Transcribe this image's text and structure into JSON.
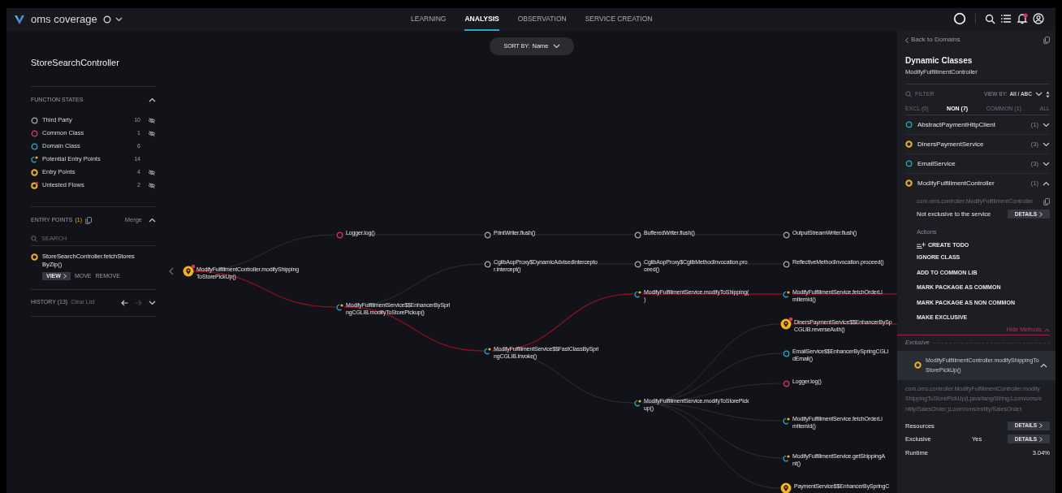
{
  "app": {
    "title": "oms coverage"
  },
  "nav_tabs": [
    {
      "label": "LEARNING",
      "selected": false
    },
    {
      "label": "ANALYSIS",
      "selected": true
    },
    {
      "label": "OBSERVATION",
      "selected": false
    },
    {
      "label": "SERVICE CREATION",
      "selected": false
    }
  ],
  "notifications": {
    "unread": true
  },
  "sort": {
    "label": "SORT BY:",
    "value": "Name"
  },
  "sidebar": {
    "title": "StoreSearchController",
    "function_states": {
      "heading": "FUNCTION STATES",
      "expanded": true,
      "items": [
        {
          "kind": "third_party",
          "label": "Third Party",
          "count": "10",
          "hidden": true
        },
        {
          "kind": "common",
          "label": "Common Class",
          "count": "1",
          "hidden": true
        },
        {
          "kind": "domain",
          "label": "Domain Class",
          "count": "6",
          "hidden": false
        },
        {
          "kind": "potential",
          "label": "Potential Entry Points",
          "count": "14",
          "hidden": false
        },
        {
          "kind": "entry",
          "label": "Entry Points",
          "count": "4",
          "hidden": true
        },
        {
          "kind": "untested",
          "label": "Untested Flows",
          "count": "2",
          "hidden": true
        }
      ]
    },
    "entry_points": {
      "heading": "ENTRY POINTS",
      "count": "(1)",
      "merge": "Merge",
      "expanded": true,
      "search_placeholder": "SEARCH",
      "items": [
        {
          "kind": "entry",
          "lines": [
            "StoreSearchController.fetchStores",
            "ByZip()"
          ],
          "actions": [
            "VIEW",
            "MOVE",
            "REMOVE"
          ]
        }
      ]
    },
    "history": {
      "heading": "HISTORY (13)",
      "clear": "Clear List",
      "forward_disabled": true,
      "expanded": false
    }
  },
  "graph": {
    "root": {
      "kind": "untested",
      "lines": [
        "ModifyFulfillmentController.modifyShipping",
        "ToStorePickUp()"
      ],
      "children": [
        {
          "kind": "common",
          "lines": [
            "Logger.log()"
          ],
          "path": false,
          "children": [
            {
              "kind": "third_party",
              "lines": [
                "PrintWriter.flush()"
              ],
              "path": false,
              "children": [
                {
                  "kind": "third_party",
                  "lines": [
                    "BufferedWriter.flush()"
                  ],
                  "path": false,
                  "children": [
                    {
                      "kind": "third_party",
                      "lines": [
                        "OutputStreamWriter.flush()"
                      ],
                      "path": false
                    }
                  ]
                }
              ]
            }
          ]
        },
        {
          "kind": "potential",
          "lines": [
            "ModifyFulfillmentService$$EnhancerBySpri",
            "ngCGLIB.modifyToStorePickup()"
          ],
          "path": true,
          "children": [
            {
              "kind": "third_party",
              "lines": [
                "CglibAopProxy$DynamicAdvisedIntercepto",
                "r.intercept()"
              ],
              "path": false,
              "children": [
                {
                  "kind": "third_party",
                  "lines": [
                    "CglibAopProxy$CglibMethodInvocation.pro",
                    "ceed()"
                  ],
                  "path": false,
                  "children": [
                    {
                      "kind": "third_party",
                      "lines": [
                        "ReflectiveMethodInvocation.proceed()"
                      ],
                      "path": false
                    }
                  ]
                }
              ]
            },
            {
              "kind": "potential",
              "lines": [
                "ModifyFulfillmentService$$FastClassBySpri",
                "ngCGLIB.invoke()"
              ],
              "path": true,
              "children": [
                {
                  "kind": "potential",
                  "lines": [
                    "ModifyFulfillmentService.modifyToShipping(",
                    ")"
                  ],
                  "path": true,
                  "children": [
                    {
                      "kind": "potential",
                      "lines": [
                        "ModifyFulfillmentService.fetchOrderLi",
                        "mItemId()"
                      ],
                      "path": true,
                      "continues": true
                    }
                  ]
                },
                {
                  "kind": "potential",
                  "lines": [
                    "ModifyFulfillmentService.modifyToStorePick",
                    "up()"
                  ],
                  "path": false,
                  "children": [
                    {
                      "kind": "untested",
                      "lines": [
                        "DinersPaymentService$$EnhancerBySp",
                        "CGLIB.reverseAuth()"
                      ],
                      "path": false,
                      "continues": true
                    },
                    {
                      "kind": "domain",
                      "lines": [
                        "EmailService$$EnhancerBySpringCGLI",
                        "dEmail()"
                      ],
                      "path": false
                    },
                    {
                      "kind": "common",
                      "lines": [
                        "Logger.log()"
                      ],
                      "path": false
                    },
                    {
                      "kind": "potential",
                      "lines": [
                        "ModifyFulfillmentService.fetchOrderLi",
                        "mItemId()"
                      ],
                      "path": false
                    },
                    {
                      "kind": "potential",
                      "lines": [
                        "ModifyFulfillmentService.getShippingA",
                        "nt()"
                      ],
                      "path": false
                    },
                    {
                      "kind": "entry",
                      "lines": [
                        "PaymentService$$EnhancerBySpringC"
                      ],
                      "path": false
                    }
                  ]
                }
              ]
            }
          ]
        }
      ]
    }
  },
  "panel": {
    "back": "Back to Domains",
    "title": "Dynamic Classes",
    "subtitle": "ModifyFulfillmentController",
    "filter_placeholder": "FILTER",
    "view_by_label": "VIEW BY:",
    "view_by_value": "All / ABC",
    "tabs": [
      {
        "label": "EXCL (0)",
        "selected": false
      },
      {
        "label": "NON (7)",
        "selected": true
      },
      {
        "label": "COMMON (1)",
        "selected": false
      },
      {
        "label": "ALL",
        "selected": false
      }
    ],
    "classes": [
      {
        "kind": "domain",
        "name": "AbstractPaymentHttpClient",
        "count": "(1)",
        "expanded": false
      },
      {
        "kind": "entry",
        "name": "DinersPaymentService",
        "count": "(3)",
        "expanded": false
      },
      {
        "kind": "domain",
        "name": "EmailService",
        "count": "(3)",
        "expanded": false
      },
      {
        "kind": "entry",
        "name": "ModifyFulfillmentController",
        "count": "(1)",
        "expanded": true
      }
    ],
    "detail": {
      "package": "com.oms.controller.ModifyFulfillmentController",
      "exclusivity": "Not exclusive to the service",
      "details": "DETAILS",
      "actions_label": "Actions",
      "actions": [
        "CREATE TODO",
        "IGNORE CLASS",
        "ADD TO COMMON LIB",
        "MARK PACKAGE AS COMMON",
        "MARK PACKAGE AS NON COMMON",
        "MAKE EXCLUSIVE"
      ],
      "hide_methods": "Hide Methods"
    },
    "section": "Exclusive",
    "method": {
      "kind": "entry",
      "name": "ModifyFulfillmentController.modifyShippingToStorePickUp()",
      "expanded": true,
      "signature": "com.oms.controller.ModifyFulfillmentController.modifyShippingToStorePickUp(Ljava/lang/String;Lcom/oms/entity/SalesOrder;)Lcom/oms/entity/SalesOrder;",
      "rows": [
        {
          "label": "Resources",
          "button": "DETAILS"
        },
        {
          "label": "Exclusive",
          "value": "Yes",
          "button": "DETAILS"
        },
        {
          "label": "Runtime",
          "value": "3.04%"
        }
      ]
    }
  }
}
